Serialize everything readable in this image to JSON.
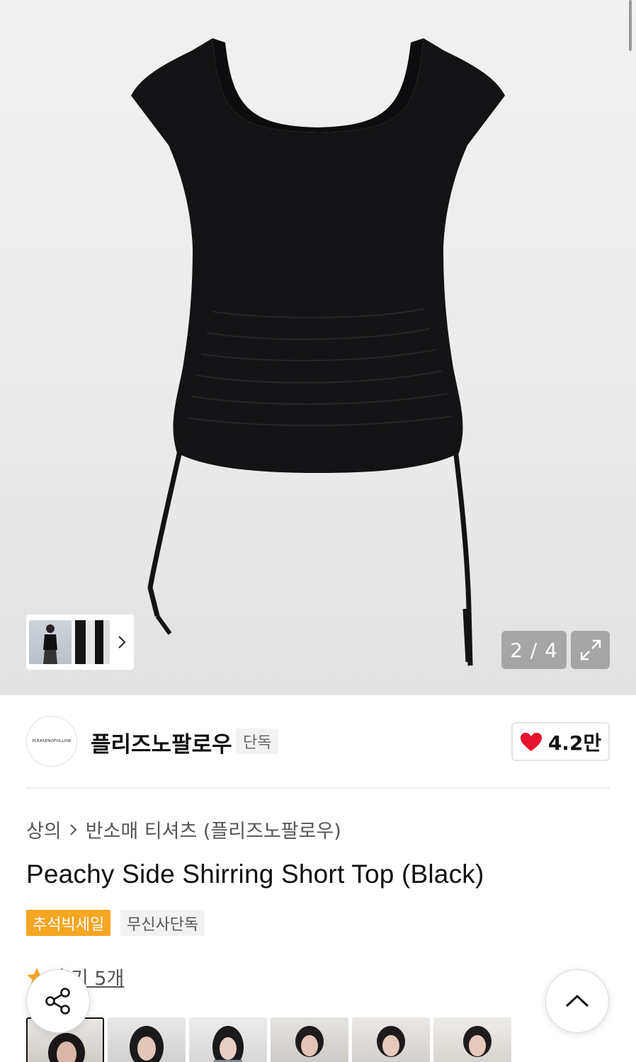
{
  "gallery": {
    "counter": "2 / 4",
    "current": 2,
    "total": 4
  },
  "brand": {
    "logo_text": "PLEASENOFOLLOW",
    "name": "플리즈노팔로우",
    "tag": "단독",
    "likes": "4.2만"
  },
  "breadcrumb": {
    "category": "상의",
    "subcategory": "반소매 티셔츠 (플리즈노팔로우)"
  },
  "product": {
    "title": "Peachy Side Shirring Short Top (Black)"
  },
  "badges": {
    "sale": "추석빅세일",
    "exclusive": "무신사단독"
  },
  "reviews": {
    "label": "후기 5개",
    "thumb_count": 6
  },
  "colors": {
    "accent": "#f5a623",
    "like_heart": "#e8112d",
    "garment": "#131315"
  },
  "icons": {
    "next": "chevron-right-icon",
    "expand": "expand-icon",
    "like": "heart-icon",
    "share": "share-icon",
    "scroll_top": "chevron-up-icon",
    "rating": "star-icon"
  }
}
